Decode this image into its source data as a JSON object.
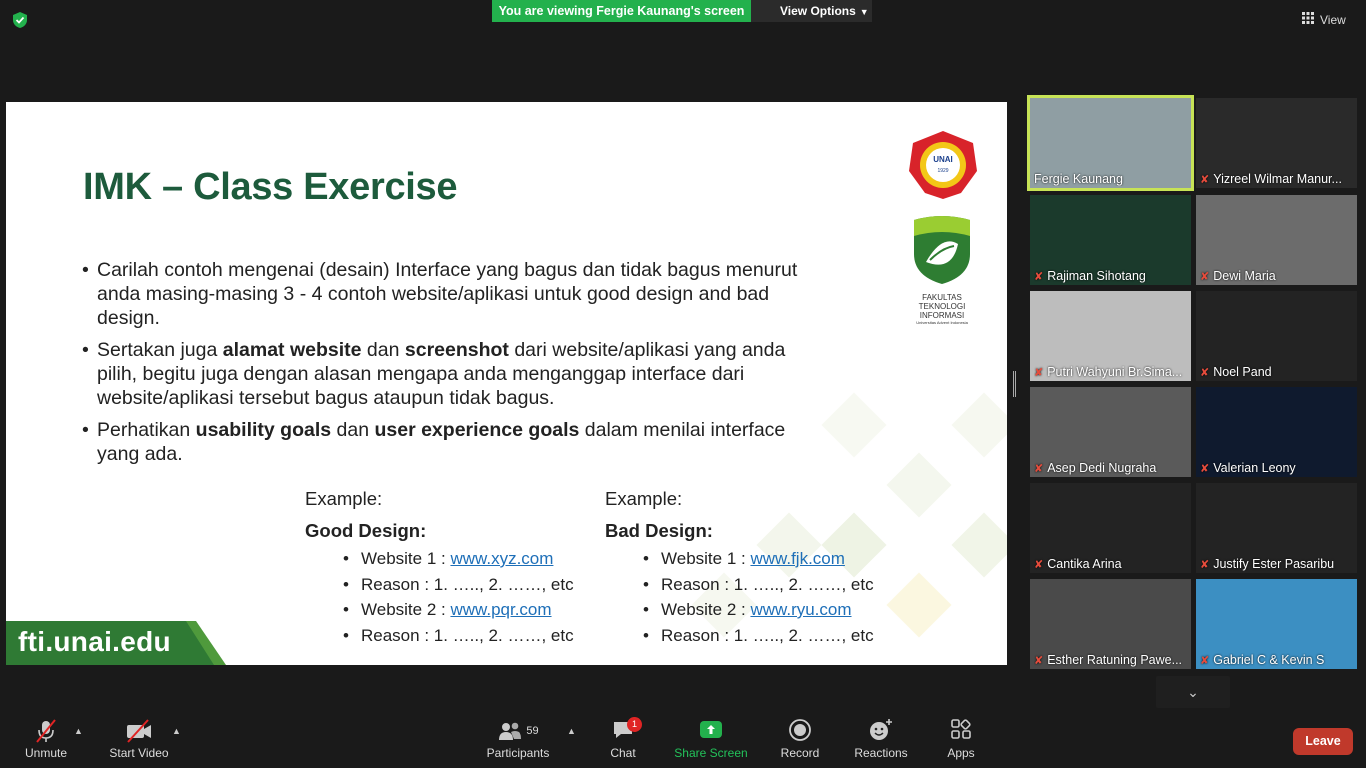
{
  "topbar": {
    "banner_text": "You are viewing Fergie Kaunang's screen",
    "view_options_label": "View Options",
    "view_label": "View"
  },
  "slide": {
    "title": "IMK – Class Exercise",
    "bullets": [
      [
        {
          "t": "Carilah contoh mengenai (desain) Interface yang bagus dan tidak bagus menurut anda masing-masing 3 - 4 contoh website/aplikasi untuk good design and bad design.",
          "b": false
        }
      ],
      [
        {
          "t": "Sertakan juga ",
          "b": false
        },
        {
          "t": "alamat website",
          "b": true
        },
        {
          "t": " dan ",
          "b": false
        },
        {
          "t": "screenshot",
          "b": true
        },
        {
          "t": " dari website/aplikasi yang anda pilih, begitu juga dengan alasan mengapa anda menganggap interface dari website/aplikasi tersebut bagus ataupun tidak bagus.",
          "b": false
        }
      ],
      [
        {
          "t": "Perhatikan ",
          "b": false
        },
        {
          "t": "usability goals",
          "b": true
        },
        {
          "t": " dan ",
          "b": false
        },
        {
          "t": "user experience goals",
          "b": true
        },
        {
          "t": " dalam menilai interface yang ada.",
          "b": false
        }
      ]
    ],
    "good": {
      "example_label": "Example:",
      "heading": "Good Design:",
      "website1_label": "Website 1 : ",
      "website1_link": "www.xyz.com",
      "reason1": "Reason : 1. ….., 2. ……, etc",
      "website2_label": "Website 2 : ",
      "website2_link": "www.pqr.com",
      "reason2": "Reason : 1. ….., 2. ……, etc"
    },
    "bad": {
      "example_label": "Example:",
      "heading": "Bad Design:",
      "website1_label": "Website 1 : ",
      "website1_link": "www.fjk.com",
      "reason1": "Reason : 1. ….., 2. ……, etc",
      "website2_label": "Website 2 : ",
      "website2_link": "www.ryu.com",
      "reason2": "Reason : 1. ….., 2. ……, etc"
    },
    "footer": "fti.unai.edu",
    "logo_texts": {
      "unai_seal": "UNIVERSITAS ADVENT INDONESIA",
      "unai_city": "BANDUNG",
      "unai_year": "1929",
      "unai_mark": "UNAI",
      "faculty_line1": "FAKULTAS",
      "faculty_line2": "TEKNOLOGI",
      "faculty_line3": "INFORMASI",
      "faculty_sub": "Universitas Advent Indonesia"
    }
  },
  "gallery": {
    "participants": [
      {
        "name": "Fergie Kaunang",
        "muted": false,
        "active": true,
        "bg": "#8f9ea3"
      },
      {
        "name": "Yizreel Wilmar Manur...",
        "muted": true,
        "active": false,
        "bg": "#2a2a2a"
      },
      {
        "name": "Rajiman Sihotang",
        "muted": true,
        "active": false,
        "bg": "#1b3a2c"
      },
      {
        "name": "Dewi Maria",
        "muted": true,
        "active": false,
        "bg": "#6c6c6c"
      },
      {
        "name": "Putri Wahyuni Br.Sima...",
        "muted": true,
        "active": false,
        "bg": "#bdbdbd"
      },
      {
        "name": "Noel Pand",
        "muted": true,
        "active": false,
        "bg": "#232323"
      },
      {
        "name": "Asep Dedi Nugraha",
        "muted": true,
        "active": false,
        "bg": "#5a5a5a"
      },
      {
        "name": "Valerian Leony",
        "muted": true,
        "active": false,
        "bg": "#0f1a2e"
      },
      {
        "name": "Cantika Arina",
        "muted": true,
        "active": false,
        "bg": "#232323"
      },
      {
        "name": "Justify Ester Pasaribu",
        "muted": true,
        "active": false,
        "bg": "#232323"
      },
      {
        "name": "Esther Ratuning Pawe...",
        "muted": true,
        "active": false,
        "bg": "#4a4a4a"
      },
      {
        "name": "Gabriel C & Kevin S",
        "muted": true,
        "active": false,
        "bg": "#3c8fc2"
      }
    ]
  },
  "toolbar": {
    "unmute": "Unmute",
    "start_video": "Start Video",
    "participants": "Participants",
    "participants_count": "59",
    "chat": "Chat",
    "chat_badge": "1",
    "share_screen": "Share Screen",
    "record": "Record",
    "reactions": "Reactions",
    "apps": "Apps",
    "leave": "Leave"
  },
  "colors": {
    "accent_green": "#23b14d",
    "leave_red": "#c0392b",
    "active_speaker": "#c7e356",
    "slide_title": "#1d5b3c",
    "link_blue": "#1e6fb8"
  }
}
